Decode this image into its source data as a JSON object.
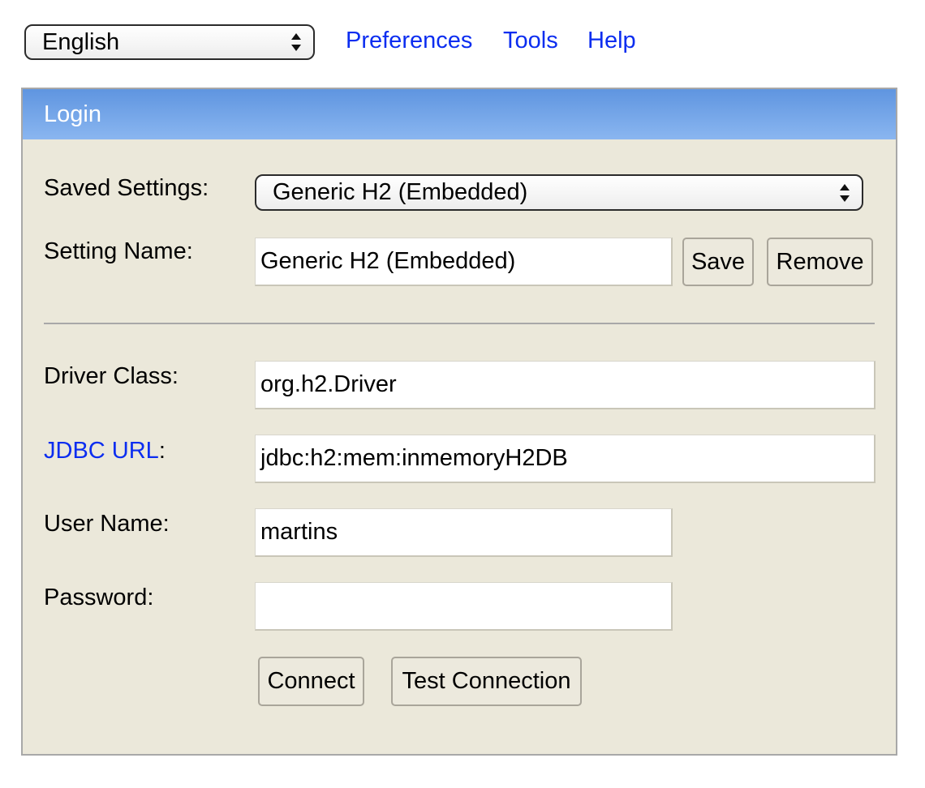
{
  "topbar": {
    "language": "English",
    "links": {
      "preferences": "Preferences",
      "tools": "Tools",
      "help": "Help"
    }
  },
  "login": {
    "header": "Login",
    "saved_settings_label": "Saved Settings:",
    "saved_settings_value": "Generic H2 (Embedded)",
    "setting_name_label": "Setting Name:",
    "setting_name_value": "Generic H2 (Embedded)",
    "save_button": "Save",
    "remove_button": "Remove",
    "driver_class_label": "Driver Class:",
    "driver_class_value": "org.h2.Driver",
    "jdbc_url_link": "JDBC URL",
    "jdbc_url_colon": ":",
    "jdbc_url_value": "jdbc:h2:mem:inmemoryH2DB",
    "user_name_label": "User Name:",
    "user_name_value": "martins",
    "password_label": "Password:",
    "password_value": "",
    "connect_button": "Connect",
    "test_connection_button": "Test Connection"
  },
  "colors": {
    "link": "#0b2df0",
    "header_gradient_top": "#5f95e0",
    "header_gradient_bottom": "#8ab6f0",
    "panel_background": "#ebe8da"
  },
  "icons": {
    "select_arrows": "updown-chevron-icon"
  }
}
